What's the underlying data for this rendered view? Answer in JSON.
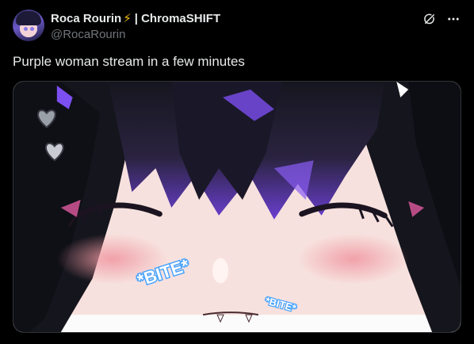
{
  "author": {
    "display_name": "Roca Rourin",
    "badge_emoji": "⚡",
    "name_suffix": "| ChromaSHIFT",
    "handle": "@RocaRourin",
    "avatar_alt": "Roca Rourin avatar"
  },
  "actions": {
    "grok_icon": "slash-circle-icon",
    "more_icon": "more-horizontal-icon"
  },
  "tweet": {
    "text": "Purple woman stream in a few minutes"
  },
  "media": {
    "sticker_large": "*BITE*",
    "sticker_small": "*BITE*",
    "colors": {
      "hair": "#1a1a24",
      "hair_highlight": "#6a3fd0",
      "skin": "#f6dcd9",
      "blush": "#f2a6ad",
      "sticker_blue": "#4aa3ff"
    }
  }
}
